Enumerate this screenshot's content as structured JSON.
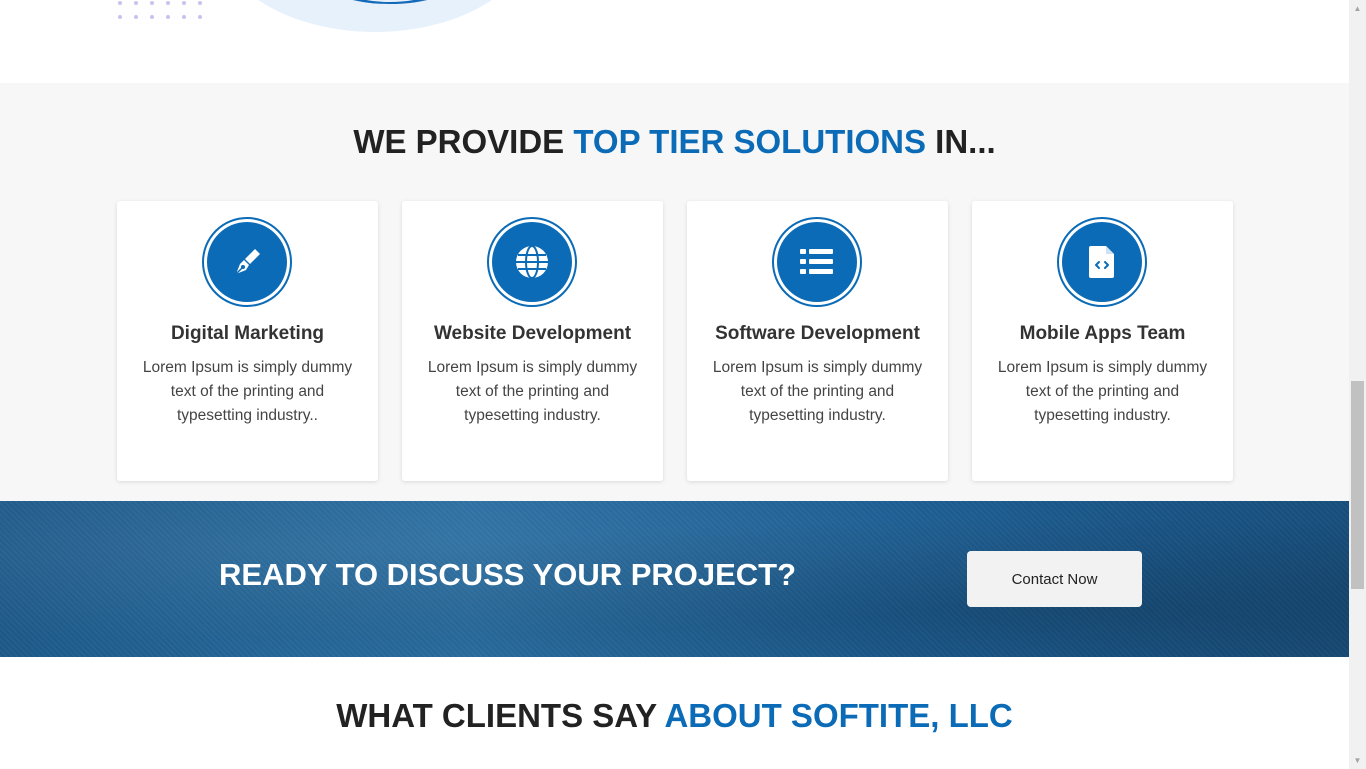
{
  "services": {
    "title_prefix": "WE PROVIDE ",
    "title_accent": "TOP TIER SOLUTIONS",
    "title_suffix": " IN...",
    "cards": [
      {
        "icon": "pen-nib-icon",
        "title": "Digital Marketing",
        "text": "Lorem Ipsum is simply dummy text of the printing and typesetting industry.."
      },
      {
        "icon": "globe-icon",
        "title": "Website Development",
        "text": "Lorem Ipsum is simply dummy text of the printing and typesetting industry."
      },
      {
        "icon": "list-icon",
        "title": "Software Development",
        "text": "Lorem Ipsum is simply dummy text of the printing and typesetting industry."
      },
      {
        "icon": "file-code-icon",
        "title": "Mobile Apps Team",
        "text": "Lorem Ipsum is simply dummy text of the printing and typesetting industry."
      }
    ]
  },
  "cta": {
    "title": "READY TO DISCUSS YOUR PROJECT?",
    "button_label": "Contact Now"
  },
  "clients": {
    "title_prefix": "WHAT CLIENTS SAY ",
    "title_accent": "ABOUT SOFTITE, LLC"
  },
  "colors": {
    "accent": "#0b6bb6",
    "section_bg": "#f7f7f7",
    "cta_bg": "#1e5a8a"
  }
}
